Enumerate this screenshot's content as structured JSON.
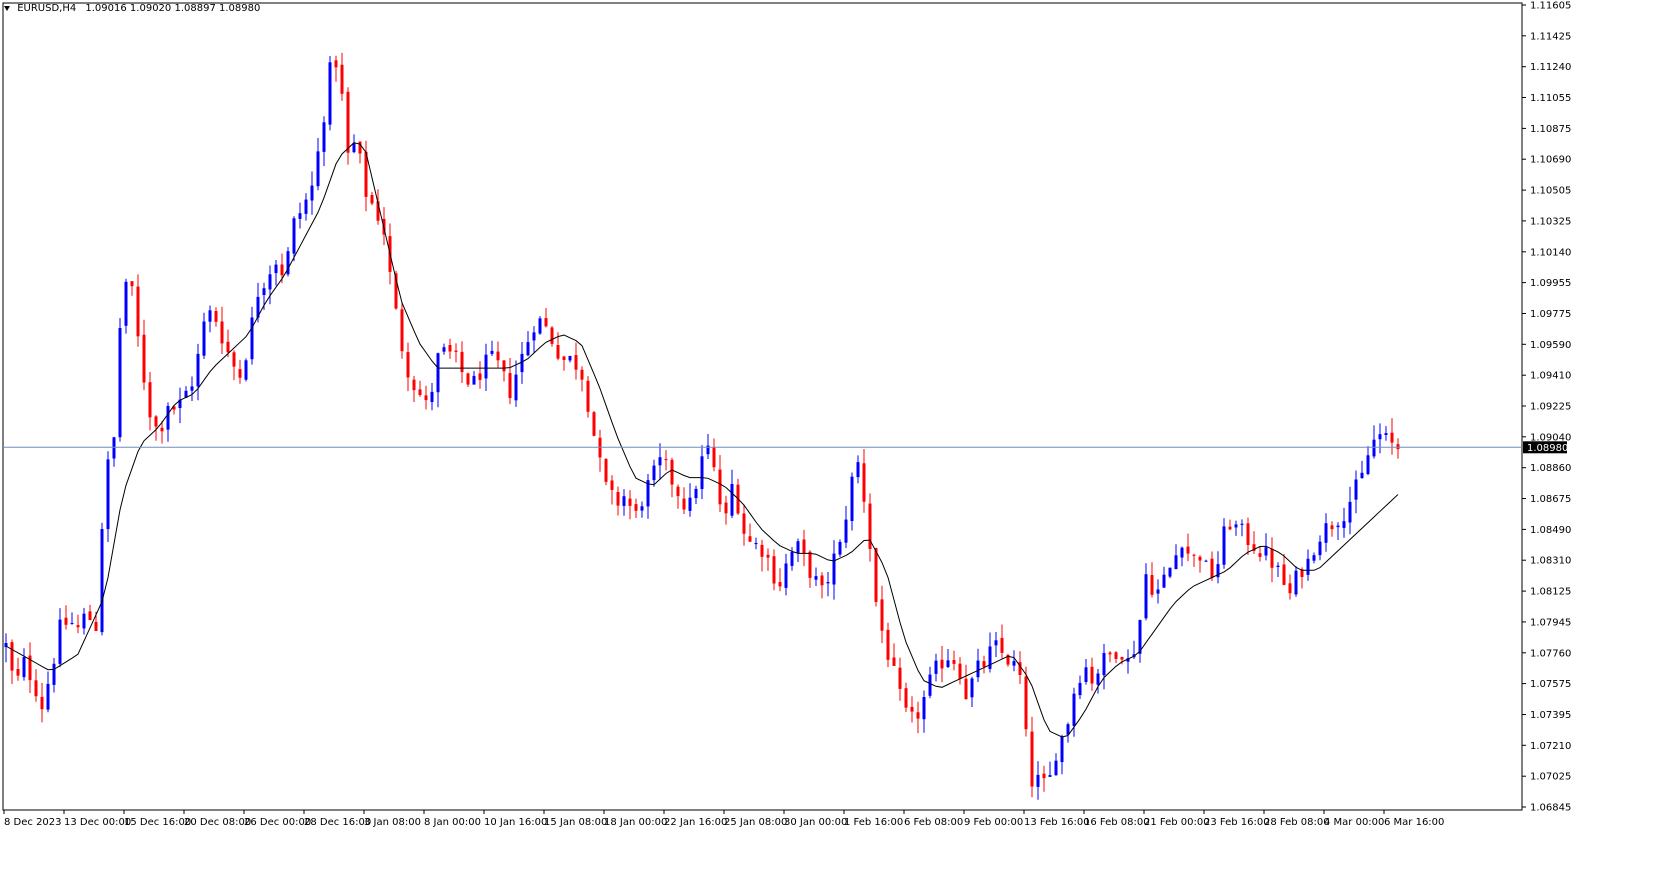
{
  "header": {
    "symbol": "EURUSD,H4",
    "ohlc": "1.09016 1.09020 1.08897 1.08980"
  },
  "colors": {
    "bull": "#0000ff",
    "bear": "#ff0000",
    "ma": "#000000",
    "price_line": "#6f8ec0",
    "price_label_bg": "#000000",
    "price_label_text": "#ffffff"
  },
  "chart_data": {
    "type": "candlestick",
    "symbol": "EURUSD",
    "timeframe": "H4",
    "current_price": "1.08980",
    "ylim": [
      1.06845,
      1.11605
    ],
    "y_ticks": [
      "1.11605",
      "1.11425",
      "1.11240",
      "1.11055",
      "1.10875",
      "1.10690",
      "1.10505",
      "1.10325",
      "1.10140",
      "1.09955",
      "1.09775",
      "1.09590",
      "1.09410",
      "1.09225",
      "1.09040",
      "1.08860",
      "1.08675",
      "1.08490",
      "1.08310",
      "1.08125",
      "1.07945",
      "1.07760",
      "1.07575",
      "1.07395",
      "1.07210",
      "1.07025",
      "1.06845"
    ],
    "x_ticks": [
      "8 Dec 2023",
      "13 Dec 00:00",
      "15 Dec 16:00",
      "20 Dec 08:00",
      "26 Dec 00:00",
      "28 Dec 16:00",
      "3 Jan 08:00",
      "8 Jan 00:00",
      "10 Jan 16:00",
      "15 Jan 08:00",
      "18 Jan 00:00",
      "22 Jan 16:00",
      "25 Jan 08:00",
      "30 Jan 00:00",
      "1 Feb 16:00",
      "6 Feb 08:00",
      "9 Feb 00:00",
      "13 Feb 16:00",
      "16 Feb 08:00",
      "21 Feb 00:00",
      "23 Feb 16:00",
      "28 Feb 08:00",
      "4 Mar 00:00",
      "6 Mar 16:00"
    ],
    "close_path": [
      [
        0,
        1.078
      ],
      [
        1,
        1.0755
      ],
      [
        2,
        1.077
      ],
      [
        3,
        1.076
      ],
      [
        4,
        1.0745
      ],
      [
        5,
        1.0765
      ],
      [
        6,
        1.079
      ],
      [
        7,
        1.0795
      ],
      [
        8,
        1.079
      ],
      [
        9,
        1.08
      ],
      [
        10,
        1.079
      ],
      [
        11,
        1.088
      ],
      [
        12,
        1.09
      ],
      [
        13,
        1.1
      ],
      [
        14,
        1.099
      ],
      [
        15,
        1.095
      ],
      [
        16,
        1.092
      ],
      [
        17,
        1.0905
      ],
      [
        18,
        1.0925
      ],
      [
        19,
        1.092
      ],
      [
        20,
        1.093
      ],
      [
        21,
        1.094
      ],
      [
        22,
        1.097
      ],
      [
        23,
        1.098
      ],
      [
        24,
        1.0965
      ],
      [
        25,
        1.095
      ],
      [
        26,
        1.094
      ],
      [
        27,
        1.096
      ],
      [
        28,
        1.099
      ],
      [
        29,
        1.1
      ],
      [
        30,
        1.101
      ],
      [
        31,
        1.1
      ],
      [
        32,
        1.103
      ],
      [
        33,
        1.104
      ],
      [
        34,
        1.105
      ],
      [
        35,
        1.108
      ],
      [
        36,
        1.112
      ],
      [
        37,
        1.113
      ],
      [
        38,
        1.107
      ],
      [
        39,
        1.108
      ],
      [
        40,
        1.105
      ],
      [
        41,
        1.104
      ],
      [
        42,
        1.103
      ],
      [
        43,
        1.099
      ],
      [
        44,
        1.096
      ],
      [
        45,
        1.094
      ],
      [
        46,
        1.093
      ],
      [
        47,
        1.092
      ],
      [
        48,
        1.095
      ],
      [
        49,
        1.0955
      ],
      [
        50,
        1.095
      ],
      [
        51,
        1.094
      ],
      [
        52,
        1.0935
      ],
      [
        53,
        1.0945
      ],
      [
        54,
        1.095
      ],
      [
        55,
        1.0945
      ],
      [
        56,
        1.093
      ],
      [
        57,
        1.0945
      ],
      [
        58,
        1.096
      ],
      [
        59,
        1.0975
      ],
      [
        60,
        1.097
      ],
      [
        61,
        1.096
      ],
      [
        62,
        1.095
      ],
      [
        63,
        1.095
      ],
      [
        64,
        1.0945
      ],
      [
        65,
        1.092
      ],
      [
        66,
        1.089
      ],
      [
        67,
        1.087
      ],
      [
        68,
        1.0865
      ],
      [
        69,
        1.087
      ],
      [
        70,
        1.0855
      ],
      [
        71,
        1.087
      ],
      [
        72,
        1.088
      ],
      [
        73,
        1.089
      ],
      [
        74,
        1.088
      ],
      [
        75,
        1.087
      ],
      [
        76,
        1.086
      ],
      [
        77,
        1.088
      ],
      [
        78,
        1.09
      ],
      [
        79,
        1.088
      ],
      [
        80,
        1.085
      ],
      [
        81,
        1.088
      ],
      [
        82,
        1.085
      ],
      [
        83,
        1.084
      ],
      [
        84,
        1.084
      ],
      [
        85,
        1.083
      ],
      [
        86,
        1.0815
      ],
      [
        87,
        1.083
      ],
      [
        88,
        1.084
      ],
      [
        89,
        1.083
      ],
      [
        90,
        1.082
      ],
      [
        91,
        1.081
      ],
      [
        92,
        1.083
      ],
      [
        93,
        1.084
      ],
      [
        94,
        1.0875
      ],
      [
        95,
        1.089
      ],
      [
        96,
        1.085
      ],
      [
        97,
        1.08
      ],
      [
        98,
        1.078
      ],
      [
        99,
        1.076
      ],
      [
        100,
        1.074
      ],
      [
        101,
        1.0735
      ],
      [
        102,
        1.0745
      ],
      [
        103,
        1.076
      ],
      [
        104,
        1.077
      ],
      [
        105,
        1.0775
      ],
      [
        106,
        1.077
      ],
      [
        107,
        1.075
      ],
      [
        108,
        1.0765
      ],
      [
        109,
        1.077
      ],
      [
        110,
        1.078
      ],
      [
        111,
        1.0775
      ],
      [
        112,
        1.077
      ],
      [
        113,
        1.076
      ],
      [
        114,
        1.07
      ],
      [
        115,
        1.07
      ],
      [
        116,
        1.0695
      ],
      [
        117,
        1.072
      ],
      [
        118,
        1.073
      ],
      [
        119,
        1.0755
      ],
      [
        120,
        1.077
      ],
      [
        121,
        1.076
      ],
      [
        122,
        1.077
      ],
      [
        123,
        1.0775
      ],
      [
        124,
        1.078
      ],
      [
        125,
        1.077
      ],
      [
        126,
        1.0785
      ],
      [
        127,
        1.0825
      ],
      [
        128,
        1.081
      ],
      [
        129,
        1.082
      ],
      [
        130,
        1.083
      ],
      [
        131,
        1.0845
      ],
      [
        132,
        1.083
      ],
      [
        133,
        1.0835
      ],
      [
        134,
        1.082
      ],
      [
        135,
        1.083
      ],
      [
        136,
        1.0855
      ],
      [
        137,
        1.085
      ],
      [
        138,
        1.0845
      ],
      [
        139,
        1.084
      ],
      [
        140,
        1.0835
      ],
      [
        141,
        1.083
      ],
      [
        142,
        1.082
      ],
      [
        143,
        1.081
      ],
      [
        144,
        1.0825
      ],
      [
        145,
        1.083
      ],
      [
        146,
        1.0845
      ],
      [
        147,
        1.085
      ],
      [
        148,
        1.0855
      ],
      [
        149,
        1.086
      ],
      [
        150,
        1.087
      ],
      [
        151,
        1.088
      ],
      [
        152,
        1.09
      ],
      [
        153,
        1.0905
      ],
      [
        154,
        1.09
      ],
      [
        155,
        1.0898
      ]
    ],
    "ma_path": [
      [
        0,
        1.078
      ],
      [
        5,
        1.0765
      ],
      [
        8,
        1.0775
      ],
      [
        11,
        1.081
      ],
      [
        13,
        1.087
      ],
      [
        15,
        1.09
      ],
      [
        17,
        1.091
      ],
      [
        19,
        1.0925
      ],
      [
        21,
        1.093
      ],
      [
        23,
        1.0945
      ],
      [
        25,
        1.0955
      ],
      [
        27,
        1.0965
      ],
      [
        29,
        1.0985
      ],
      [
        31,
        1.1
      ],
      [
        33,
        1.102
      ],
      [
        35,
        1.104
      ],
      [
        37,
        1.107
      ],
      [
        39,
        1.108
      ],
      [
        40,
        1.1075
      ],
      [
        42,
        1.103
      ],
      [
        44,
        1.0985
      ],
      [
        46,
        1.096
      ],
      [
        48,
        1.0945
      ],
      [
        50,
        1.0945
      ],
      [
        52,
        1.0945
      ],
      [
        54,
        1.0945
      ],
      [
        56,
        1.0945
      ],
      [
        58,
        1.095
      ],
      [
        60,
        1.096
      ],
      [
        62,
        1.0965
      ],
      [
        64,
        1.096
      ],
      [
        66,
        1.0935
      ],
      [
        68,
        1.0905
      ],
      [
        70,
        1.088
      ],
      [
        72,
        1.0875
      ],
      [
        74,
        1.0885
      ],
      [
        76,
        1.088
      ],
      [
        78,
        1.088
      ],
      [
        80,
        1.0875
      ],
      [
        82,
        1.0865
      ],
      [
        84,
        1.085
      ],
      [
        86,
        1.084
      ],
      [
        88,
        1.0835
      ],
      [
        90,
        1.0835
      ],
      [
        92,
        1.083
      ],
      [
        94,
        1.0835
      ],
      [
        96,
        1.0845
      ],
      [
        98,
        1.0825
      ],
      [
        100,
        1.0785
      ],
      [
        102,
        1.076
      ],
      [
        104,
        1.0755
      ],
      [
        106,
        1.076
      ],
      [
        108,
        1.0765
      ],
      [
        110,
        1.077
      ],
      [
        112,
        1.0775
      ],
      [
        114,
        1.076
      ],
      [
        116,
        1.073
      ],
      [
        118,
        1.0725
      ],
      [
        120,
        1.074
      ],
      [
        122,
        1.076
      ],
      [
        124,
        1.077
      ],
      [
        126,
        1.0775
      ],
      [
        128,
        1.079
      ],
      [
        130,
        1.0805
      ],
      [
        132,
        1.0815
      ],
      [
        134,
        1.082
      ],
      [
        136,
        1.0825
      ],
      [
        138,
        1.0835
      ],
      [
        140,
        1.084
      ],
      [
        142,
        1.0835
      ],
      [
        144,
        1.0825
      ],
      [
        146,
        1.0825
      ],
      [
        148,
        1.0835
      ],
      [
        150,
        1.0845
      ],
      [
        152,
        1.0855
      ],
      [
        154,
        1.0865
      ],
      [
        155,
        1.087
      ]
    ]
  }
}
